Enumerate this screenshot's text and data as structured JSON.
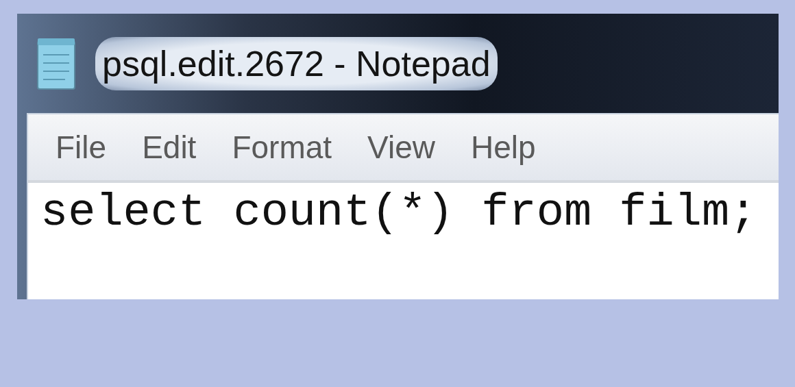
{
  "window": {
    "title": "psql.edit.2672 - Notepad"
  },
  "menu": [
    "File",
    "Edit",
    "Format",
    "View",
    "Help"
  ],
  "editor": {
    "text": "select count(*) from film;"
  }
}
